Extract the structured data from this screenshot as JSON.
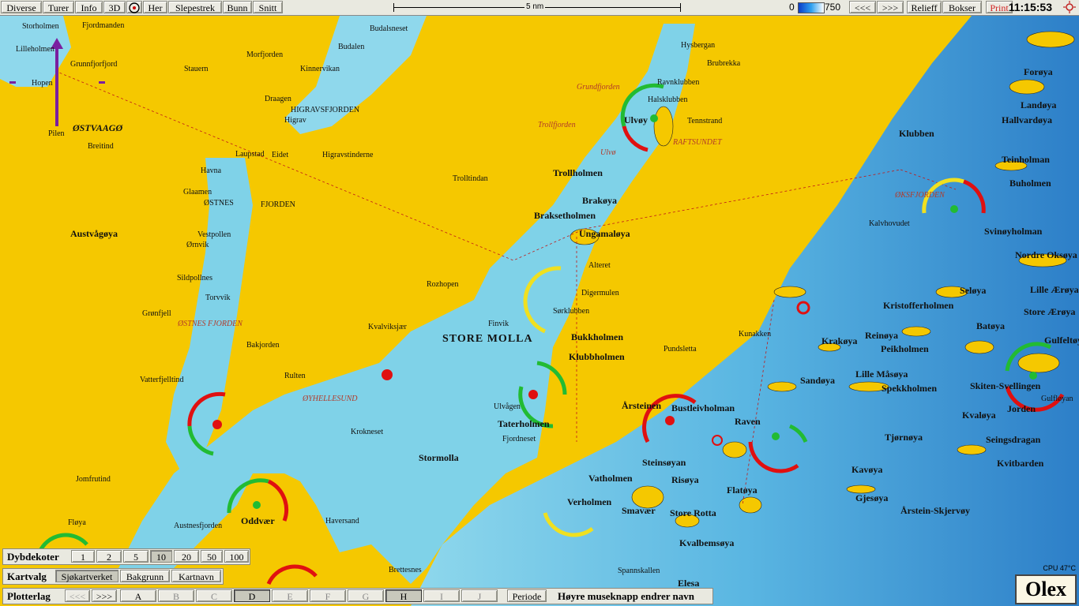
{
  "toolbar": {
    "left_buttons": [
      "Diverse",
      "Turer",
      "Info",
      "3D",
      "Her",
      "Slepestrek",
      "Bunn",
      "Snitt"
    ],
    "scale_label": "5 nm",
    "depth_min": "0",
    "depth_max": "750",
    "right_buttons": [
      "<<<",
      ">>>",
      "Relieff",
      "Bokser",
      "Print"
    ],
    "clock": "11:15:53"
  },
  "map_labels": {
    "areas": [
      "Austvågøya",
      "STORE MOLLA",
      "Stormolla",
      "ØSTVAAGØ",
      "HIGRAVSFJORDEN",
      "ØSTNES",
      "FJORDEN"
    ],
    "islands": [
      "Trollholmen",
      "Brakøya",
      "Braksetholmen",
      "Ungamaløya",
      "Bukkholmen",
      "Klubbholmen",
      "Ulvøy",
      "Taterholmen",
      "Vatholmen",
      "Verholmen",
      "Oddvær",
      "Årsteinen",
      "Bustleivholman",
      "Steinsøyan",
      "Risøya",
      "Flatøya",
      "Smavær",
      "Store Rotta",
      "Kvalbemsøya",
      "Raven",
      "Klubben",
      "Teinholman",
      "Buholmen",
      "Svinøyholman",
      "Nordre Oksøya",
      "Kristofferholmen",
      "Seløya",
      "Batøya",
      "Store Ærøya",
      "Lille Ærøya",
      "Krakøya",
      "Reinøya",
      "Peikholmen",
      "Sandøya",
      "Lille Måsøya",
      "Spekkholmen",
      "Tjørnøya",
      "Kavøya",
      "Gjesøya",
      "Årstein-Skjervøy",
      "Kvitbarden",
      "Seingsdragan",
      "Skiten-Svellingen",
      "Jorden",
      "Kvaløya",
      "Gulfeltøya",
      "Landøya",
      "Hallvardøya",
      "Forøya",
      "Fløya",
      "Elesa"
    ],
    "places": [
      "Storholmen",
      "Lilleholmen",
      "Fjordmanden",
      "Grunnfjorfjord",
      "Stauern",
      "Hopen",
      "Pilen",
      "Breitind",
      "Havna",
      "Laupstad",
      "Glaamen",
      "Vestpollen",
      "Ørnvik",
      "Sildpollnes",
      "Torvvik",
      "Grønfjell",
      "Vatterfjelltind",
      "Jomfrutind",
      "Morfjorden",
      "Kinnervikan",
      "Draagen",
      "Higrav",
      "Eidet",
      "Budalsneset",
      "Budalen",
      "Trolltindan",
      "Higravstinderne",
      "Brubrekka",
      "Hysbergan",
      "Ravnklubben",
      "Halsklubben",
      "Tennstrand",
      "Alteret",
      "Digermulen",
      "Sørklubben",
      "Rozhopen",
      "Kvalviksjær",
      "Finvik",
      "Ulvågen",
      "Fjordneset",
      "Krokneset",
      "Haversand",
      "Austnesfjorden",
      "Bakjorden",
      "Rulten",
      "Kunakken",
      "Pundsletta",
      "Spannskallen",
      "Brettesnes",
      "Kalvhovudet",
      "Gulfløyan"
    ],
    "red_labels": [
      "RAFTSUNDET",
      "ØSTNES FJORDEN",
      "ØYHELLESUND",
      "Trollfjorden",
      "Grundfjorden",
      "Ulvø",
      "ØKSFJORDEN"
    ]
  },
  "bottom": {
    "depth_title": "Dybdekoter",
    "depth_buttons": [
      "1",
      "2",
      "5",
      "10",
      "20",
      "50",
      "100"
    ],
    "depth_selected": "10",
    "chart_title": "Kartvalg",
    "chart_buttons": [
      "Sjøkartverket",
      "Bakgrunn",
      "Kartnavn"
    ],
    "chart_selected": "Sjøkartverket",
    "plotter_title": "Plotterlag",
    "plotter_nav": [
      "<<<",
      ">>>"
    ],
    "plotter_layers": [
      "A",
      "B",
      "C",
      "D",
      "E",
      "F",
      "G",
      "H",
      "I",
      "J"
    ],
    "plotter_selected": [
      "D",
      "H"
    ],
    "period_label": "Periode",
    "hint": "Høyre museknapp endrer navn"
  },
  "status": {
    "cpu": "CPU 47°C",
    "brand": "Olex"
  },
  "colors": {
    "land": "#f5c800",
    "water": "#7fd2e8",
    "deep_water": "#2a7fc9",
    "toolbar": "#e9e9e0",
    "red_label": "#b23a2a",
    "ring_red": "#e01010",
    "ring_green": "#22bb33",
    "ring_yellow": "#f0e020"
  }
}
